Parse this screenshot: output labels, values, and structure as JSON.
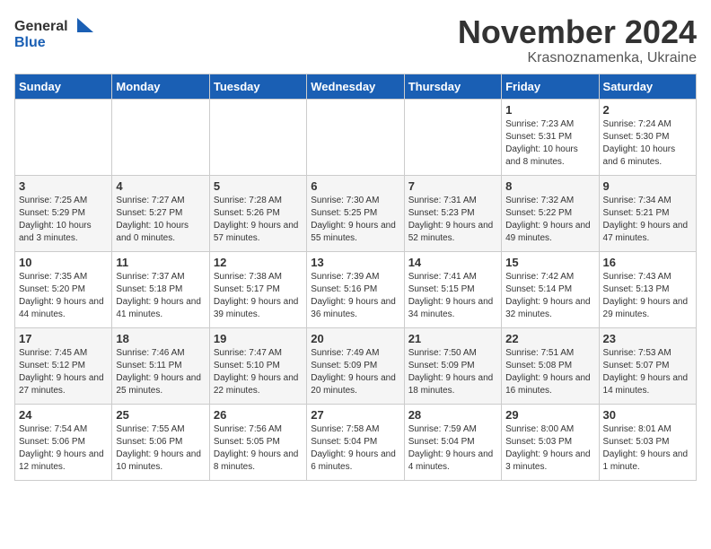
{
  "logo": {
    "line1": "General",
    "line2": "Blue"
  },
  "title": "November 2024",
  "subtitle": "Krasnoznamenka, Ukraine",
  "days_header": [
    "Sunday",
    "Monday",
    "Tuesday",
    "Wednesday",
    "Thursday",
    "Friday",
    "Saturday"
  ],
  "weeks": [
    [
      {
        "day": "",
        "info": ""
      },
      {
        "day": "",
        "info": ""
      },
      {
        "day": "",
        "info": ""
      },
      {
        "day": "",
        "info": ""
      },
      {
        "day": "",
        "info": ""
      },
      {
        "day": "1",
        "info": "Sunrise: 7:23 AM\nSunset: 5:31 PM\nDaylight: 10 hours and 8 minutes."
      },
      {
        "day": "2",
        "info": "Sunrise: 7:24 AM\nSunset: 5:30 PM\nDaylight: 10 hours and 6 minutes."
      }
    ],
    [
      {
        "day": "3",
        "info": "Sunrise: 7:25 AM\nSunset: 5:29 PM\nDaylight: 10 hours and 3 minutes."
      },
      {
        "day": "4",
        "info": "Sunrise: 7:27 AM\nSunset: 5:27 PM\nDaylight: 10 hours and 0 minutes."
      },
      {
        "day": "5",
        "info": "Sunrise: 7:28 AM\nSunset: 5:26 PM\nDaylight: 9 hours and 57 minutes."
      },
      {
        "day": "6",
        "info": "Sunrise: 7:30 AM\nSunset: 5:25 PM\nDaylight: 9 hours and 55 minutes."
      },
      {
        "day": "7",
        "info": "Sunrise: 7:31 AM\nSunset: 5:23 PM\nDaylight: 9 hours and 52 minutes."
      },
      {
        "day": "8",
        "info": "Sunrise: 7:32 AM\nSunset: 5:22 PM\nDaylight: 9 hours and 49 minutes."
      },
      {
        "day": "9",
        "info": "Sunrise: 7:34 AM\nSunset: 5:21 PM\nDaylight: 9 hours and 47 minutes."
      }
    ],
    [
      {
        "day": "10",
        "info": "Sunrise: 7:35 AM\nSunset: 5:20 PM\nDaylight: 9 hours and 44 minutes."
      },
      {
        "day": "11",
        "info": "Sunrise: 7:37 AM\nSunset: 5:18 PM\nDaylight: 9 hours and 41 minutes."
      },
      {
        "day": "12",
        "info": "Sunrise: 7:38 AM\nSunset: 5:17 PM\nDaylight: 9 hours and 39 minutes."
      },
      {
        "day": "13",
        "info": "Sunrise: 7:39 AM\nSunset: 5:16 PM\nDaylight: 9 hours and 36 minutes."
      },
      {
        "day": "14",
        "info": "Sunrise: 7:41 AM\nSunset: 5:15 PM\nDaylight: 9 hours and 34 minutes."
      },
      {
        "day": "15",
        "info": "Sunrise: 7:42 AM\nSunset: 5:14 PM\nDaylight: 9 hours and 32 minutes."
      },
      {
        "day": "16",
        "info": "Sunrise: 7:43 AM\nSunset: 5:13 PM\nDaylight: 9 hours and 29 minutes."
      }
    ],
    [
      {
        "day": "17",
        "info": "Sunrise: 7:45 AM\nSunset: 5:12 PM\nDaylight: 9 hours and 27 minutes."
      },
      {
        "day": "18",
        "info": "Sunrise: 7:46 AM\nSunset: 5:11 PM\nDaylight: 9 hours and 25 minutes."
      },
      {
        "day": "19",
        "info": "Sunrise: 7:47 AM\nSunset: 5:10 PM\nDaylight: 9 hours and 22 minutes."
      },
      {
        "day": "20",
        "info": "Sunrise: 7:49 AM\nSunset: 5:09 PM\nDaylight: 9 hours and 20 minutes."
      },
      {
        "day": "21",
        "info": "Sunrise: 7:50 AM\nSunset: 5:09 PM\nDaylight: 9 hours and 18 minutes."
      },
      {
        "day": "22",
        "info": "Sunrise: 7:51 AM\nSunset: 5:08 PM\nDaylight: 9 hours and 16 minutes."
      },
      {
        "day": "23",
        "info": "Sunrise: 7:53 AM\nSunset: 5:07 PM\nDaylight: 9 hours and 14 minutes."
      }
    ],
    [
      {
        "day": "24",
        "info": "Sunrise: 7:54 AM\nSunset: 5:06 PM\nDaylight: 9 hours and 12 minutes."
      },
      {
        "day": "25",
        "info": "Sunrise: 7:55 AM\nSunset: 5:06 PM\nDaylight: 9 hours and 10 minutes."
      },
      {
        "day": "26",
        "info": "Sunrise: 7:56 AM\nSunset: 5:05 PM\nDaylight: 9 hours and 8 minutes."
      },
      {
        "day": "27",
        "info": "Sunrise: 7:58 AM\nSunset: 5:04 PM\nDaylight: 9 hours and 6 minutes."
      },
      {
        "day": "28",
        "info": "Sunrise: 7:59 AM\nSunset: 5:04 PM\nDaylight: 9 hours and 4 minutes."
      },
      {
        "day": "29",
        "info": "Sunrise: 8:00 AM\nSunset: 5:03 PM\nDaylight: 9 hours and 3 minutes."
      },
      {
        "day": "30",
        "info": "Sunrise: 8:01 AM\nSunset: 5:03 PM\nDaylight: 9 hours and 1 minute."
      }
    ]
  ]
}
